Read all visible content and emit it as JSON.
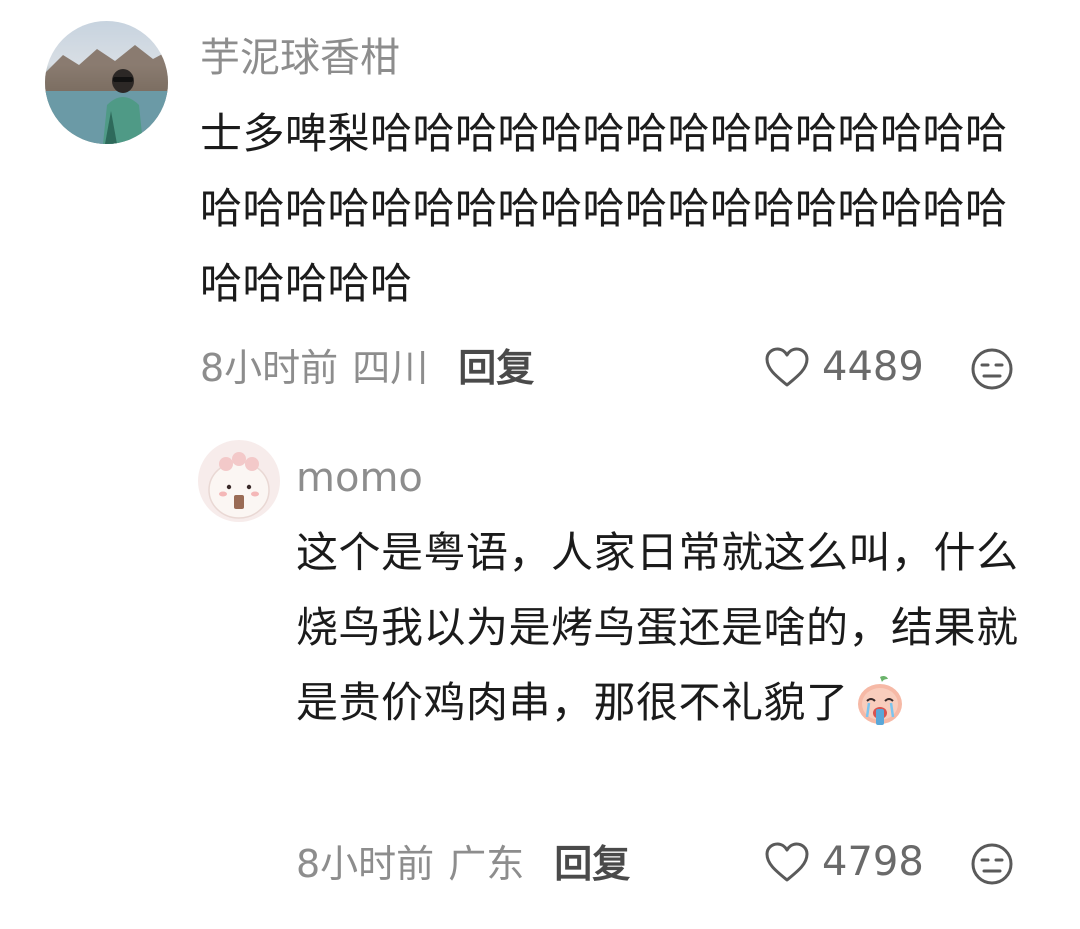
{
  "comments": [
    {
      "username": "芋泥球香柑",
      "text": "士多啤梨哈哈哈哈哈哈哈哈哈哈哈哈哈哈哈哈哈哈哈哈哈哈哈哈哈哈哈哈哈哈哈哈哈哈哈哈哈哈哈",
      "time": "8小时前",
      "location": "四川",
      "reply_label": "回复",
      "likes": "4489",
      "avatar_icon": "user-photo-avatar",
      "like_icon": "heart-outline-icon",
      "dislike_icon": "meh-face-icon"
    },
    {
      "username": "momo",
      "text": "这个是粤语，人家日常就这么叫，什么烧鸟我以为是烤鸟蛋还是啥的，结果就是贵价鸡肉串，那很不礼貌了",
      "emoji": "crying-drinking-sticker",
      "time": "8小时前",
      "location": "广东",
      "reply_label": "回复",
      "likes": "4798",
      "avatar_icon": "cartoon-avatar",
      "like_icon": "heart-outline-icon",
      "dislike_icon": "meh-face-icon"
    }
  ],
  "colors": {
    "muted_text": "#8d8d8d",
    "body_text": "#1b1b1b",
    "icon_stroke": "#5a5a5a"
  }
}
